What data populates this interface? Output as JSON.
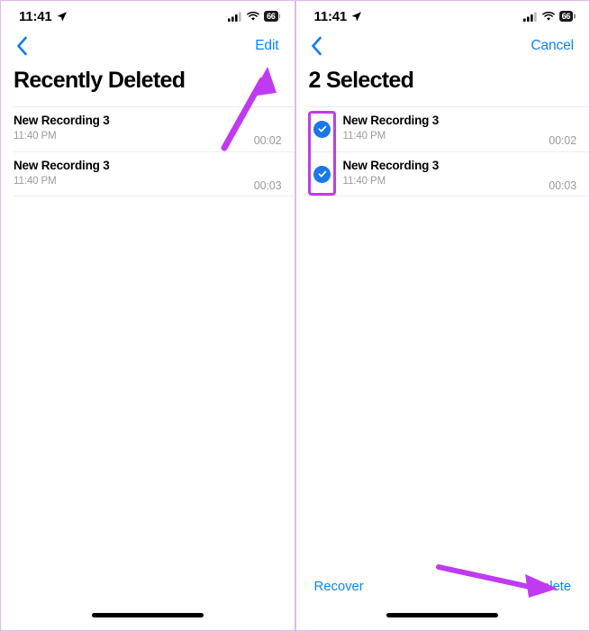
{
  "colors": {
    "accent_blue": "#0a84ff",
    "checkbox_blue": "#1878e8",
    "annotation_purple": "#c03bf0",
    "panel_border": "#e3b8f0",
    "secondary_text": "#9a9a9f"
  },
  "screens": [
    {
      "id": "recently-deleted-browse",
      "status_bar": {
        "time": "11:41",
        "location_icon": "location-arrow-icon",
        "cellular_icon": "cellular-signal-icon",
        "wifi_icon": "wifi-icon",
        "battery_level": "66"
      },
      "nav": {
        "back_icon": "chevron-left-icon",
        "action_label": "Edit"
      },
      "title": "Recently Deleted",
      "recordings": [
        {
          "name": "New Recording 3",
          "time": "11:40 PM",
          "duration": "00:02"
        },
        {
          "name": "New Recording 3",
          "time": "11:40 PM",
          "duration": "00:03"
        }
      ],
      "annotations": [
        {
          "type": "arrow",
          "target": "Edit",
          "direction": "up-right"
        }
      ]
    },
    {
      "id": "recently-deleted-selection",
      "status_bar": {
        "time": "11:41",
        "location_icon": "location-arrow-icon",
        "cellular_icon": "cellular-signal-icon",
        "wifi_icon": "wifi-icon",
        "battery_level": "66"
      },
      "nav": {
        "back_icon": "chevron-left-icon",
        "action_label": "Cancel"
      },
      "title": "2 Selected",
      "recordings": [
        {
          "name": "New Recording 3",
          "time": "11:40 PM",
          "duration": "00:02",
          "selected": true
        },
        {
          "name": "New Recording 3",
          "time": "11:40 PM",
          "duration": "00:03",
          "selected": true
        }
      ],
      "bottom_bar": {
        "recover_label": "Recover",
        "delete_label": "Delete"
      },
      "annotations": [
        {
          "type": "box",
          "target": "selection-checkboxes"
        },
        {
          "type": "arrow",
          "target": "Delete",
          "direction": "right"
        }
      ]
    }
  ]
}
